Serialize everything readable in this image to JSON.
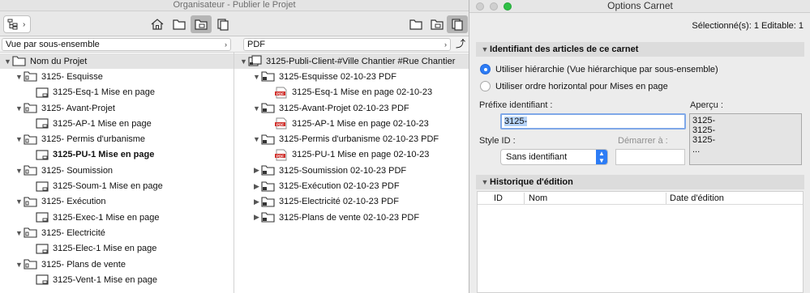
{
  "organizer": {
    "title": "Organisateur - Publier le Projet",
    "left_view": "Vue par sous-ensemble",
    "right_view": "PDF",
    "left_tree": [
      {
        "label": "Nom du Projet",
        "level": 0,
        "expanded": true,
        "root": true,
        "icon": "project-folder-icon"
      },
      {
        "label": "3125- Esquisse",
        "level": 1,
        "expanded": true,
        "icon": "subset-folder-icon"
      },
      {
        "label": "3125-Esq-1 Mise en page",
        "level": 2,
        "icon": "layout-icon"
      },
      {
        "label": "3125- Avant-Projet",
        "level": 1,
        "expanded": true,
        "icon": "subset-folder-icon"
      },
      {
        "label": "3125-AP-1 Mise en page",
        "level": 2,
        "icon": "layout-icon"
      },
      {
        "label": "3125- Permis d'urbanisme",
        "level": 1,
        "expanded": true,
        "icon": "subset-folder-icon"
      },
      {
        "label": "3125-PU-1 Mise en page",
        "level": 2,
        "icon": "layout-icon",
        "bold": true
      },
      {
        "label": "3125- Soumission",
        "level": 1,
        "expanded": true,
        "icon": "subset-folder-icon"
      },
      {
        "label": "3125-Soum-1 Mise en page",
        "level": 2,
        "icon": "layout-icon"
      },
      {
        "label": "3125- Exécution",
        "level": 1,
        "expanded": true,
        "icon": "subset-folder-icon"
      },
      {
        "label": "3125-Exec-1 Mise en page",
        "level": 2,
        "icon": "layout-icon"
      },
      {
        "label": "3125- Electricité",
        "level": 1,
        "expanded": true,
        "icon": "subset-folder-icon"
      },
      {
        "label": "3125-Elec-1 Mise en page",
        "level": 2,
        "icon": "layout-icon"
      },
      {
        "label": "3125- Plans de vente",
        "level": 1,
        "expanded": true,
        "icon": "subset-folder-icon"
      },
      {
        "label": "3125-Vent-1 Mise en page",
        "level": 2,
        "icon": "layout-icon"
      }
    ],
    "right_tree": [
      {
        "label": "3125-Publi-Client-#Ville Chantier #Rue Chantier",
        "level": 0,
        "expanded": true,
        "root": true,
        "icon": "publisher-set-icon"
      },
      {
        "label": "3125-Esquisse 02-10-23 PDF",
        "level": 1,
        "expanded": true,
        "icon": "publish-folder-icon"
      },
      {
        "label": "3125-Esq-1  Mise en page 02-10-23",
        "level": 2,
        "icon": "pdf-icon"
      },
      {
        "label": "3125-Avant-Projet 02-10-23 PDF",
        "level": 1,
        "expanded": true,
        "icon": "publish-folder-icon"
      },
      {
        "label": "3125-AP-1  Mise en page 02-10-23",
        "level": 2,
        "icon": "pdf-icon"
      },
      {
        "label": "3125-Permis d'urbanisme 02-10-23 PDF",
        "level": 1,
        "expanded": true,
        "icon": "publish-folder-icon"
      },
      {
        "label": "3125-PU-1  Mise en page 02-10-23",
        "level": 2,
        "icon": "pdf-icon"
      },
      {
        "label": "3125-Soumission 02-10-23 PDF",
        "level": 1,
        "expanded": false,
        "icon": "publish-folder-icon"
      },
      {
        "label": "3125-Exécution 02-10-23 PDF",
        "level": 1,
        "expanded": false,
        "icon": "publish-folder-icon"
      },
      {
        "label": "3125-Electricité 02-10-23 PDF",
        "level": 1,
        "expanded": false,
        "icon": "publish-folder-icon"
      },
      {
        "label": "3125-Plans de vente 02-10-23 PDF",
        "level": 1,
        "expanded": false,
        "icon": "publish-folder-icon"
      }
    ]
  },
  "options": {
    "title": "Options Carnet",
    "selection_info": "Sélectionné(s): 1 Editable: 1",
    "identifier_section": "Identifiant des articles de ce carnet",
    "radio_hierarchy": "Utiliser hiérarchie (Vue hiérarchique par sous-ensemble)",
    "radio_horizontal": "Utiliser ordre horizontal pour Mises en page",
    "prefix_label": "Préfixe identifiant :",
    "prefix_value": "3125-",
    "preview_label": "Aperçu :",
    "preview_lines": [
      "3125-",
      "3125-",
      "3125-",
      "..."
    ],
    "style_label": "Style ID :",
    "style_value": "Sans identifiant",
    "start_label": "Démarrer à :",
    "history_section": "Historique d'édition",
    "history_columns": [
      "ID",
      "Nom",
      "Date d'édition"
    ]
  },
  "colors": {
    "accent": "#2d7cf5",
    "pdf_red": "#d0312d",
    "traffic_green": "#2fc046"
  }
}
